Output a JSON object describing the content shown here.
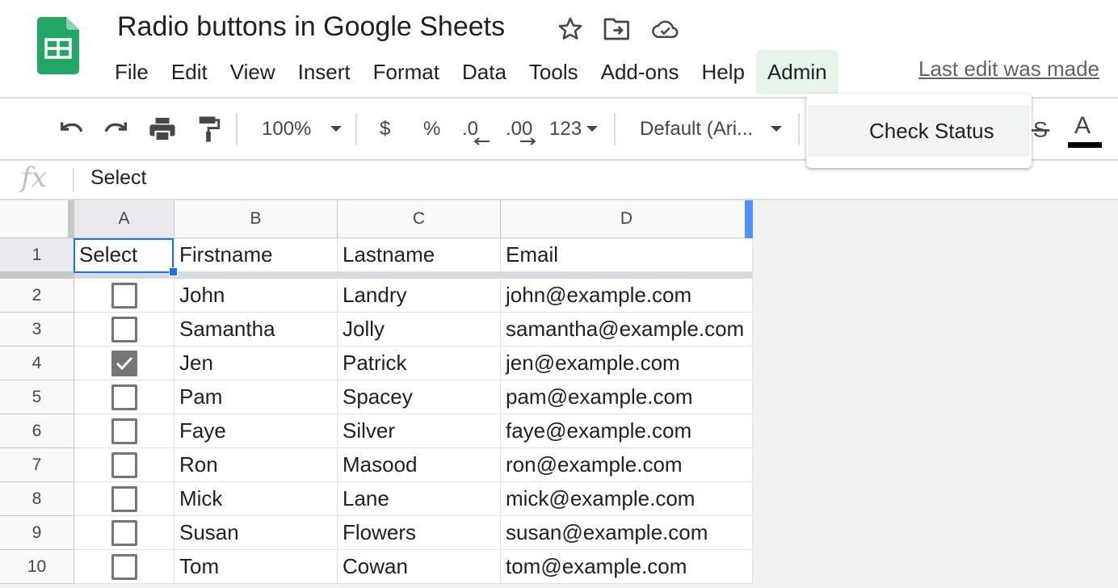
{
  "app": {
    "document_title": "Radio buttons in Google Sheets",
    "last_edit": "Last edit was made",
    "colors": {
      "brand_green": "#23a566",
      "selection_blue": "#1a73e8",
      "active_menu_bg": "#e6f4ea"
    }
  },
  "menubar": {
    "items": [
      "File",
      "Edit",
      "View",
      "Insert",
      "Format",
      "Data",
      "Tools",
      "Add-ons",
      "Help",
      "Admin"
    ],
    "active": "Admin"
  },
  "admin_menu": {
    "items": [
      "Check Status"
    ]
  },
  "toolbar": {
    "zoom": "100%",
    "currency": "$",
    "percent": "%",
    "decrease_decimal": ".0",
    "increase_decimal": ".00",
    "more_formats": "123",
    "font": "Default (Ari...",
    "text_color_letter": "A",
    "icons": [
      "undo-icon",
      "redo-icon",
      "print-icon",
      "paint-format-icon",
      "strikethrough-icon",
      "text-color-icon"
    ]
  },
  "formula_bar": {
    "label": "fx",
    "value": "Select"
  },
  "grid": {
    "column_letters": [
      "A",
      "B",
      "C",
      "D"
    ],
    "row_numbers": [
      "1",
      "2",
      "3",
      "4",
      "5",
      "6",
      "7",
      "8",
      "9",
      "10"
    ],
    "headers": [
      "Select",
      "Firstname",
      "Lastname",
      "Email"
    ],
    "rows": [
      {
        "checked": false,
        "firstname": "John",
        "lastname": "Landry",
        "email": "john@example.com"
      },
      {
        "checked": false,
        "firstname": "Samantha",
        "lastname": "Jolly",
        "email": "samantha@example.com"
      },
      {
        "checked": true,
        "firstname": "Jen",
        "lastname": "Patrick",
        "email": "jen@example.com"
      },
      {
        "checked": false,
        "firstname": "Pam",
        "lastname": "Spacey",
        "email": "pam@example.com"
      },
      {
        "checked": false,
        "firstname": "Faye",
        "lastname": "Silver",
        "email": "faye@example.com"
      },
      {
        "checked": false,
        "firstname": "Ron",
        "lastname": "Masood",
        "email": "ron@example.com"
      },
      {
        "checked": false,
        "firstname": "Mick",
        "lastname": "Lane",
        "email": "mick@example.com"
      },
      {
        "checked": false,
        "firstname": "Susan",
        "lastname": "Flowers",
        "email": "susan@example.com"
      },
      {
        "checked": false,
        "firstname": "Tom",
        "lastname": "Cowan",
        "email": "tom@example.com"
      }
    ],
    "active_cell": "A1"
  }
}
